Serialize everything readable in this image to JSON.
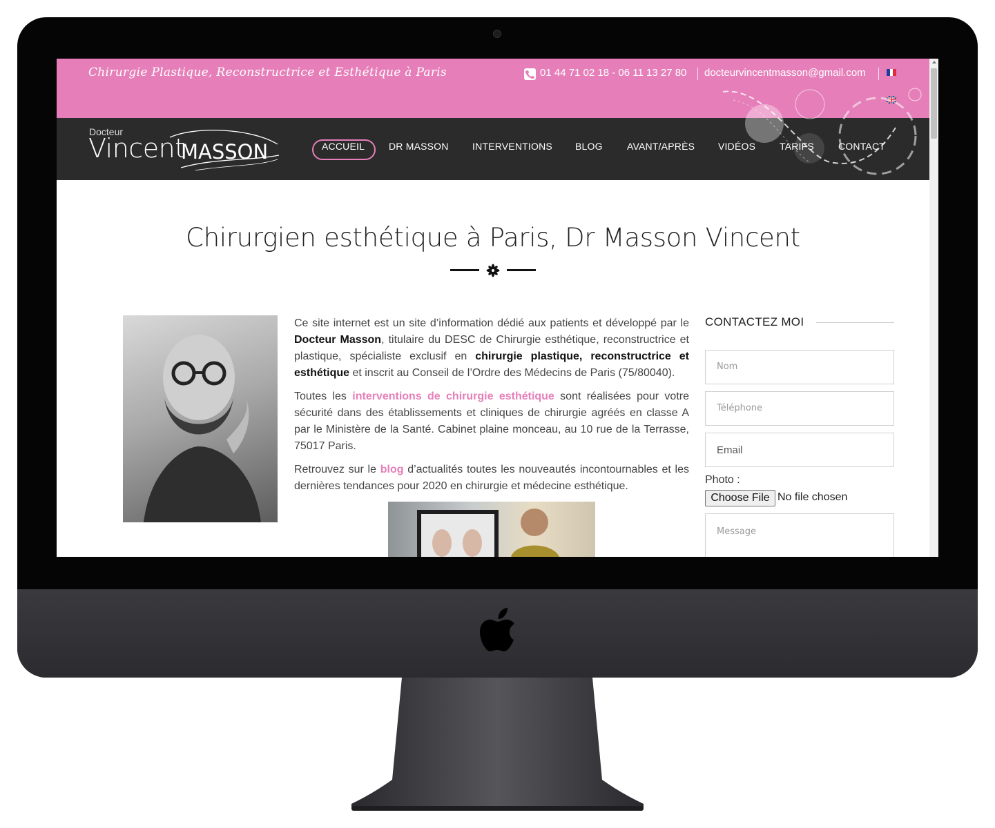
{
  "header": {
    "tagline": "Chirurgie Plastique, Reconstructrice et Esthétique à Paris",
    "phone": "01 44 71 02 18 - 06 11 13 27 80",
    "email": "docteurvincentmasson@gmail.com"
  },
  "logo": {
    "docteur": "Docteur",
    "vincent": "Vincent",
    "masson": "MASSON"
  },
  "nav": {
    "items": [
      "ACCUEIL",
      "DR MASSON",
      "INTERVENTIONS",
      "BLOG",
      "AVANT/APRÈS",
      "VIDÉOS",
      "TARIFS",
      "CONTACT"
    ],
    "active_index": 0
  },
  "main": {
    "title": "Chirurgien esthétique à Paris, Dr Masson Vincent",
    "p1": {
      "a": "Ce site internet est un site d’information dédié aux patients et développé par le ",
      "b": "Docteur Masson",
      "c": ", titulaire du DESC de Chirurgie esthétique, reconstructrice et plastique, spécialiste exclusif  en ",
      "d": "chirurgie plastique, reconstructrice et esthétique",
      "e": " et inscrit au Conseil de l’Ordre des Médecins de Paris (75/80040)."
    },
    "p2": {
      "a": "Toutes les ",
      "link": "interventions de chirurgie esthétique",
      "b": " sont réalisées pour votre sécurité dans des établissements et cliniques de chirurgie agréés en classe A par le Ministère de la Santé. Cabinet plaine monceau, au 10 rue de la Terrasse, 75017 Paris."
    },
    "p3": {
      "a": "Retrouvez sur le ",
      "link": "blog",
      "b": " d’actualités toutes les nouveautés incontournables et les dernières tendances pour 2020 en chirurgie et médecine esthétique."
    }
  },
  "contact": {
    "heading": "CONTACTEZ MOI",
    "name_placeholder": "Nom",
    "phone_placeholder": "Téléphone",
    "email_placeholder": "Email",
    "photo_label": "Photo :",
    "file_button": "Choose File",
    "file_status": "No file chosen",
    "message_placeholder": "Message"
  },
  "colors": {
    "accent_pink": "#e67fb9",
    "nav_dark": "#2b2b2b"
  }
}
